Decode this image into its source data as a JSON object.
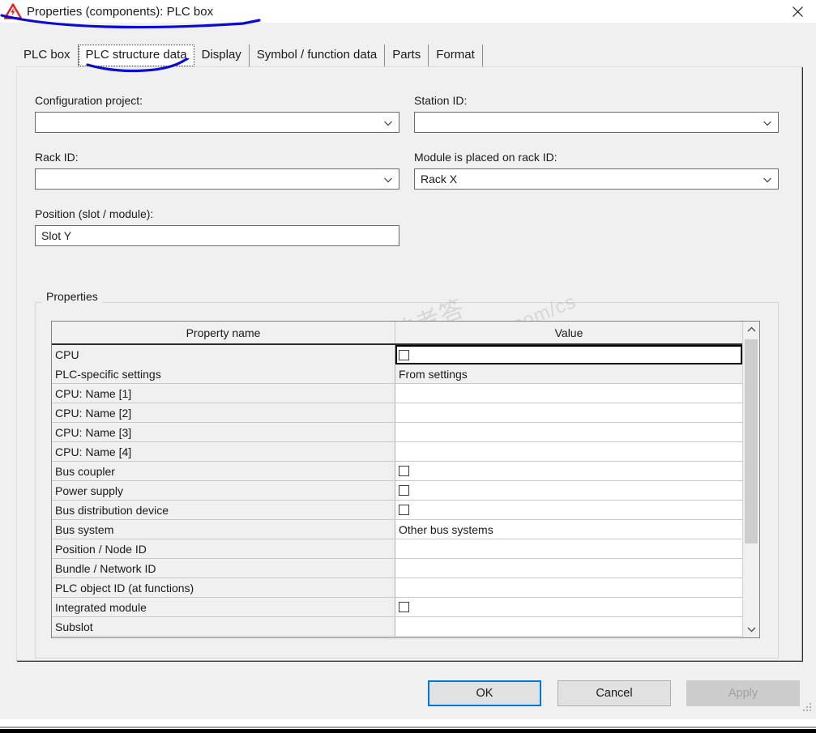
{
  "window": {
    "title": "Properties (components): PLC box",
    "icon": "electrical-hazard-warning-icon",
    "close_label": "✕"
  },
  "tabs": [
    {
      "label": "PLC box",
      "selected": false
    },
    {
      "label": "PLC structure data",
      "selected": true
    },
    {
      "label": "Display",
      "selected": false
    },
    {
      "label": "Symbol / function data",
      "selected": false
    },
    {
      "label": "Parts",
      "selected": false
    },
    {
      "label": "Format",
      "selected": false
    }
  ],
  "form": {
    "configuration_project": {
      "label": "Configuration project:",
      "value": "",
      "type": "combobox"
    },
    "station_id": {
      "label": "Station ID:",
      "value": "",
      "type": "combobox"
    },
    "rack_id": {
      "label": "Rack ID:",
      "value": "",
      "type": "combobox"
    },
    "module_on_rack_id": {
      "label": "Module is placed on rack ID:",
      "value": "Rack X",
      "type": "combobox"
    },
    "position_slot_module": {
      "label": "Position (slot / module):",
      "value": "Slot Y",
      "type": "textbox"
    }
  },
  "properties_group": {
    "legend": "Properties",
    "columns": [
      "Property name",
      "Value"
    ],
    "rows": [
      {
        "name": "CPU",
        "value": "",
        "kind": "checkbox",
        "checked": false,
        "focused": true,
        "shaded": false
      },
      {
        "name": "PLC-specific settings",
        "value": "From settings",
        "kind": "text",
        "shaded": true
      },
      {
        "name": "CPU: Name [1]",
        "value": "",
        "kind": "text",
        "shaded": false
      },
      {
        "name": "CPU: Name [2]",
        "value": "",
        "kind": "text",
        "shaded": false
      },
      {
        "name": "CPU: Name [3]",
        "value": "",
        "kind": "text",
        "shaded": false
      },
      {
        "name": "CPU: Name [4]",
        "value": "",
        "kind": "text",
        "shaded": false
      },
      {
        "name": "Bus coupler",
        "value": "",
        "kind": "checkbox",
        "checked": false,
        "shaded": false
      },
      {
        "name": "Power supply",
        "value": "",
        "kind": "checkbox",
        "checked": false,
        "shaded": false
      },
      {
        "name": "Bus distribution device",
        "value": "",
        "kind": "checkbox",
        "checked": false,
        "shaded": false
      },
      {
        "name": "Bus system",
        "value": "Other bus systems",
        "kind": "text",
        "shaded": false
      },
      {
        "name": "Position / Node ID",
        "value": "",
        "kind": "text",
        "shaded": false
      },
      {
        "name": "Bundle / Network ID",
        "value": "",
        "kind": "text",
        "shaded": false
      },
      {
        "name": "PLC object ID (at functions)",
        "value": "",
        "kind": "text",
        "shaded": false
      },
      {
        "name": "Integrated module",
        "value": "",
        "kind": "checkbox",
        "checked": false,
        "shaded": false
      },
      {
        "name": "Subslot",
        "value": "",
        "kind": "text",
        "shaded": false
      }
    ],
    "scrollbar": {
      "up_icon": "chevron-up-icon",
      "down_icon": "chevron-down-icon"
    }
  },
  "footer": {
    "ok": "OK",
    "cancel": "Cancel",
    "apply": "Apply",
    "apply_disabled": true
  },
  "watermark": {
    "line1": "西门子工业技者答",
    "line2": "support.industry.siemens.com/cs"
  },
  "colors": {
    "accent_focus": "#0078d7",
    "dialog_bg": "#f0f0f0",
    "annotation_ink": "#0a0ad2",
    "hazard_red": "#e02020"
  }
}
